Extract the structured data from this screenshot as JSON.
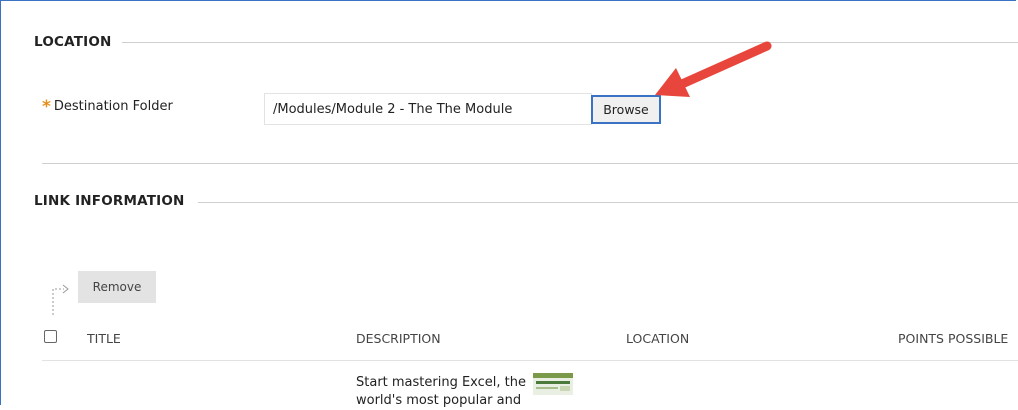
{
  "location": {
    "heading": "LOCATION",
    "destination_label": "Destination Folder",
    "destination_value": "/Modules/Module 2 - The The Module",
    "browse_label": "Browse"
  },
  "link_information": {
    "heading": "LINK INFORMATION",
    "remove_label": "Remove",
    "columns": [
      "TITLE",
      "DESCRIPTION",
      "LOCATION",
      "POINTS POSSIBLE"
    ],
    "rows": [
      {
        "title": "",
        "description": "Start mastering Excel, the world's most popular and",
        "location": "",
        "points": ""
      }
    ]
  },
  "colors": {
    "accent": "#3b73c4",
    "required_star": "#e8901c",
    "annotation_arrow": "#e8453c"
  }
}
